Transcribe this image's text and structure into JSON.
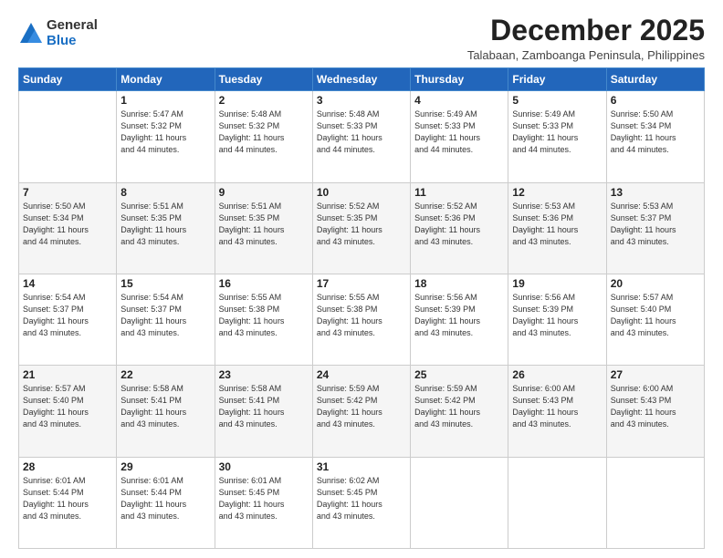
{
  "logo": {
    "general": "General",
    "blue": "Blue"
  },
  "title": "December 2025",
  "subtitle": "Talabaan, Zamboanga Peninsula, Philippines",
  "days_of_week": [
    "Sunday",
    "Monday",
    "Tuesday",
    "Wednesday",
    "Thursday",
    "Friday",
    "Saturday"
  ],
  "weeks": [
    [
      {
        "day": "",
        "info": ""
      },
      {
        "day": "1",
        "info": "Sunrise: 5:47 AM\nSunset: 5:32 PM\nDaylight: 11 hours\nand 44 minutes."
      },
      {
        "day": "2",
        "info": "Sunrise: 5:48 AM\nSunset: 5:32 PM\nDaylight: 11 hours\nand 44 minutes."
      },
      {
        "day": "3",
        "info": "Sunrise: 5:48 AM\nSunset: 5:33 PM\nDaylight: 11 hours\nand 44 minutes."
      },
      {
        "day": "4",
        "info": "Sunrise: 5:49 AM\nSunset: 5:33 PM\nDaylight: 11 hours\nand 44 minutes."
      },
      {
        "day": "5",
        "info": "Sunrise: 5:49 AM\nSunset: 5:33 PM\nDaylight: 11 hours\nand 44 minutes."
      },
      {
        "day": "6",
        "info": "Sunrise: 5:50 AM\nSunset: 5:34 PM\nDaylight: 11 hours\nand 44 minutes."
      }
    ],
    [
      {
        "day": "7",
        "info": "Sunrise: 5:50 AM\nSunset: 5:34 PM\nDaylight: 11 hours\nand 44 minutes."
      },
      {
        "day": "8",
        "info": "Sunrise: 5:51 AM\nSunset: 5:35 PM\nDaylight: 11 hours\nand 43 minutes."
      },
      {
        "day": "9",
        "info": "Sunrise: 5:51 AM\nSunset: 5:35 PM\nDaylight: 11 hours\nand 43 minutes."
      },
      {
        "day": "10",
        "info": "Sunrise: 5:52 AM\nSunset: 5:35 PM\nDaylight: 11 hours\nand 43 minutes."
      },
      {
        "day": "11",
        "info": "Sunrise: 5:52 AM\nSunset: 5:36 PM\nDaylight: 11 hours\nand 43 minutes."
      },
      {
        "day": "12",
        "info": "Sunrise: 5:53 AM\nSunset: 5:36 PM\nDaylight: 11 hours\nand 43 minutes."
      },
      {
        "day": "13",
        "info": "Sunrise: 5:53 AM\nSunset: 5:37 PM\nDaylight: 11 hours\nand 43 minutes."
      }
    ],
    [
      {
        "day": "14",
        "info": "Sunrise: 5:54 AM\nSunset: 5:37 PM\nDaylight: 11 hours\nand 43 minutes."
      },
      {
        "day": "15",
        "info": "Sunrise: 5:54 AM\nSunset: 5:37 PM\nDaylight: 11 hours\nand 43 minutes."
      },
      {
        "day": "16",
        "info": "Sunrise: 5:55 AM\nSunset: 5:38 PM\nDaylight: 11 hours\nand 43 minutes."
      },
      {
        "day": "17",
        "info": "Sunrise: 5:55 AM\nSunset: 5:38 PM\nDaylight: 11 hours\nand 43 minutes."
      },
      {
        "day": "18",
        "info": "Sunrise: 5:56 AM\nSunset: 5:39 PM\nDaylight: 11 hours\nand 43 minutes."
      },
      {
        "day": "19",
        "info": "Sunrise: 5:56 AM\nSunset: 5:39 PM\nDaylight: 11 hours\nand 43 minutes."
      },
      {
        "day": "20",
        "info": "Sunrise: 5:57 AM\nSunset: 5:40 PM\nDaylight: 11 hours\nand 43 minutes."
      }
    ],
    [
      {
        "day": "21",
        "info": "Sunrise: 5:57 AM\nSunset: 5:40 PM\nDaylight: 11 hours\nand 43 minutes."
      },
      {
        "day": "22",
        "info": "Sunrise: 5:58 AM\nSunset: 5:41 PM\nDaylight: 11 hours\nand 43 minutes."
      },
      {
        "day": "23",
        "info": "Sunrise: 5:58 AM\nSunset: 5:41 PM\nDaylight: 11 hours\nand 43 minutes."
      },
      {
        "day": "24",
        "info": "Sunrise: 5:59 AM\nSunset: 5:42 PM\nDaylight: 11 hours\nand 43 minutes."
      },
      {
        "day": "25",
        "info": "Sunrise: 5:59 AM\nSunset: 5:42 PM\nDaylight: 11 hours\nand 43 minutes."
      },
      {
        "day": "26",
        "info": "Sunrise: 6:00 AM\nSunset: 5:43 PM\nDaylight: 11 hours\nand 43 minutes."
      },
      {
        "day": "27",
        "info": "Sunrise: 6:00 AM\nSunset: 5:43 PM\nDaylight: 11 hours\nand 43 minutes."
      }
    ],
    [
      {
        "day": "28",
        "info": "Sunrise: 6:01 AM\nSunset: 5:44 PM\nDaylight: 11 hours\nand 43 minutes."
      },
      {
        "day": "29",
        "info": "Sunrise: 6:01 AM\nSunset: 5:44 PM\nDaylight: 11 hours\nand 43 minutes."
      },
      {
        "day": "30",
        "info": "Sunrise: 6:01 AM\nSunset: 5:45 PM\nDaylight: 11 hours\nand 43 minutes."
      },
      {
        "day": "31",
        "info": "Sunrise: 6:02 AM\nSunset: 5:45 PM\nDaylight: 11 hours\nand 43 minutes."
      },
      {
        "day": "",
        "info": ""
      },
      {
        "day": "",
        "info": ""
      },
      {
        "day": "",
        "info": ""
      }
    ]
  ]
}
